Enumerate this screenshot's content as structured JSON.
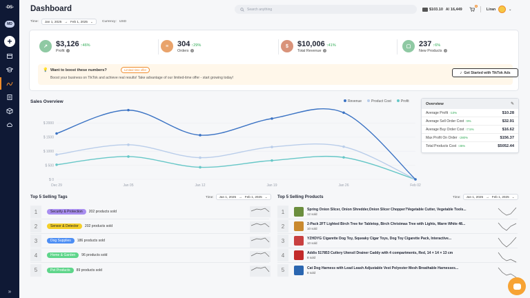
{
  "sidebar": {
    "logo": "-DS-",
    "mode_badge": "MD",
    "icons": [
      "box-icon",
      "graduation-cap-icon",
      "chart-icon",
      "list-icon",
      "cube-icon",
      "cloud-icon"
    ],
    "expand": "»"
  },
  "header": {
    "title": "Dashboard",
    "search_placeholder": "Search anything",
    "currency_display": "$103.10",
    "points_display": "16,449",
    "notification_count": "4",
    "user_name": "Liran"
  },
  "filters": {
    "time_label": "Time:",
    "date_start": "Jan 1, 2025",
    "date_sep": "→",
    "date_end": "Feb 1, 2025",
    "currency_label": "Currency:",
    "currency_value": "USD"
  },
  "stats": [
    {
      "value": "$3,126",
      "change": "46%",
      "label": "Profit",
      "color": "#8fc9a3",
      "icon": "chart-icon"
    },
    {
      "value": "304",
      "change": "29%",
      "label": "Orders",
      "color": "#e9a36b",
      "icon": "clipboard-icon"
    },
    {
      "value": "$10,006",
      "change": "41%",
      "label": "Total Revenue",
      "color": "#d9937a",
      "icon": "dollar-icon"
    },
    {
      "value": "237",
      "change": "6%",
      "label": "New Products",
      "color": "#8fc9a3",
      "icon": "box-icon"
    }
  ],
  "promo": {
    "question": "Want to boost these numbers?",
    "limited": "Limited time offer",
    "description": "Boost your business on TikTok and achieve real results! Take advantage of our limited-time offer - start growing today!",
    "button": "Get Started with TikTok Ads"
  },
  "sales": {
    "title": "Sales Overview",
    "legend": [
      "Revenue",
      "Product Cost",
      "Profit"
    ]
  },
  "chart_data": {
    "type": "line",
    "x": [
      "Dec 29",
      "Jan 05",
      "Jan 12",
      "Jan 19",
      "Jan 26",
      "Feb 02"
    ],
    "ytick_labels": [
      "$ 2000",
      "$ 1500",
      "$ 1000",
      "$ 500",
      "$ 0"
    ],
    "ylim": [
      0,
      2500
    ],
    "series": [
      {
        "name": "Revenue",
        "color": "#3b73c4",
        "values": [
          1630,
          2460,
          1570,
          2160,
          2370,
          0
        ]
      },
      {
        "name": "Product Cost",
        "color": "#b9cdea",
        "values": [
          880,
          1230,
          770,
          1150,
          1160,
          0
        ]
      },
      {
        "name": "Profit",
        "color": "#66c7c7",
        "values": [
          520,
          810,
          430,
          670,
          780,
          0
        ]
      }
    ],
    "grid": true,
    "legend_position": "top-right"
  },
  "overview": {
    "title": "Overview",
    "rows": [
      {
        "label": "Average Profit",
        "change": "10%",
        "value": "$10.28"
      },
      {
        "label": "Average Sell Order Cost",
        "change": "9%",
        "value": "$32.91"
      },
      {
        "label": "Average Buy Order Cost",
        "change": "7.5%",
        "value": "$16.62"
      },
      {
        "label": "Max Profit On Order",
        "change": "280%",
        "value": "$156.37"
      },
      {
        "label": "Total Products Cost",
        "change": "35%",
        "value": "$5052.44"
      }
    ]
  },
  "tags": {
    "title": "Top 5 Selling Tags",
    "time_label": "Time:",
    "date_start": "Jan 1, 2025",
    "date_sep": "→",
    "date_end": "Feb 1, 2025",
    "rows": [
      {
        "rank": "1",
        "tag": "Security & Protection",
        "color": "#a98ef0",
        "sold": "202 products sold"
      },
      {
        "rank": "2",
        "tag": "Sensor & Detector",
        "color": "#f4cf2a",
        "sold": "202 products sold"
      },
      {
        "rank": "3",
        "tag": "Dog Supplies",
        "color": "#4d8ef4",
        "sold": "186 products sold"
      },
      {
        "rank": "4",
        "tag": "Home & Garden",
        "color": "#5ed58a",
        "sold": "96 products sold"
      },
      {
        "rank": "5",
        "tag": "Pet Products",
        "color": "#5ed58a",
        "sold": "89 products sold"
      }
    ]
  },
  "products": {
    "title": "Top 5 Selling Products",
    "time_label": "Time:",
    "date_start": "Jan 1, 2025",
    "date_sep": "→",
    "date_end": "Feb 1, 2025",
    "rows": [
      {
        "rank": "1",
        "name": "Spring Onion Slicer, Onion Shredder,Onion Slicer Chopper?Vegetable Cutter, Vegetable Tools...",
        "sold": "12 sold",
        "color": "#6b8e3e"
      },
      {
        "rank": "2",
        "name": "2-Pack 2FT Lighted Birch Tree for Tabletop, Birch Christmas Tree with Lights, Warm White 48...",
        "sold": "10 sold",
        "color": "#c9892e"
      },
      {
        "rank": "3",
        "name": "YZHDYG Cigarette Dog Toy, Squeaky Cigar Toys, Dog Toy Cigarette Pack, Interactive...",
        "sold": "10 sold",
        "color": "#c84040"
      },
      {
        "rank": "4",
        "name": "Addis 517853 Cutlery Utensil Drainer Caddy with 4 compartments, Red, 14 × 14 × 13 cm",
        "sold": "8 sold",
        "color": "#c22a2a"
      },
      {
        "rank": "5",
        "name": "Cat Dog Harness with Lead Leash Adjustable Vest Polyester Mesh Breathable Harnesses...",
        "sold": "8 sold",
        "color": "#2a66b0"
      }
    ]
  }
}
